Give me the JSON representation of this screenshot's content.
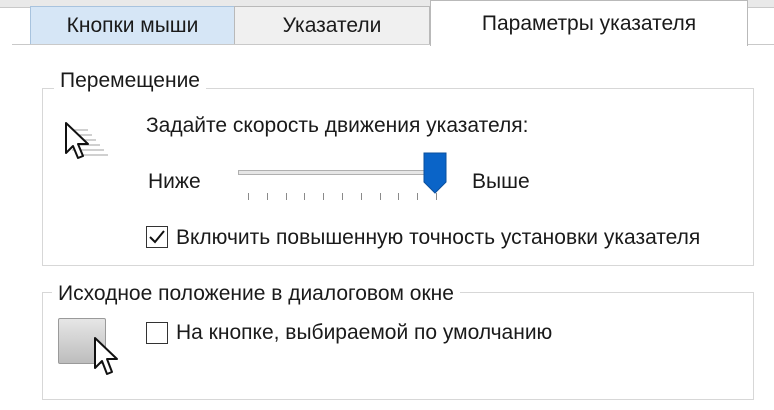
{
  "tabs": [
    {
      "label": "Кнопки мыши"
    },
    {
      "label": "Указатели"
    },
    {
      "label": "Параметры указателя"
    }
  ],
  "motion": {
    "legend": "Перемещение",
    "speed_label": "Задайте скорость движения указателя:",
    "slow_label": "Ниже",
    "fast_label": "Выше",
    "speed_value_fraction": 1.0,
    "precision_label": "Включить повышенную точность установки указателя",
    "precision_checked": true,
    "icon": "pointer-speed-icon"
  },
  "snap_to": {
    "legend": "Исходное положение в диалоговом окне",
    "option_label": "На кнопке, выбираемой по умолчанию",
    "option_checked": false,
    "icon": "snap-to-button-icon"
  },
  "colors": {
    "accent": "#0a64c8",
    "selected_tab": "#ffffff",
    "inactive_tab_highlight": "#d6e6f6"
  }
}
